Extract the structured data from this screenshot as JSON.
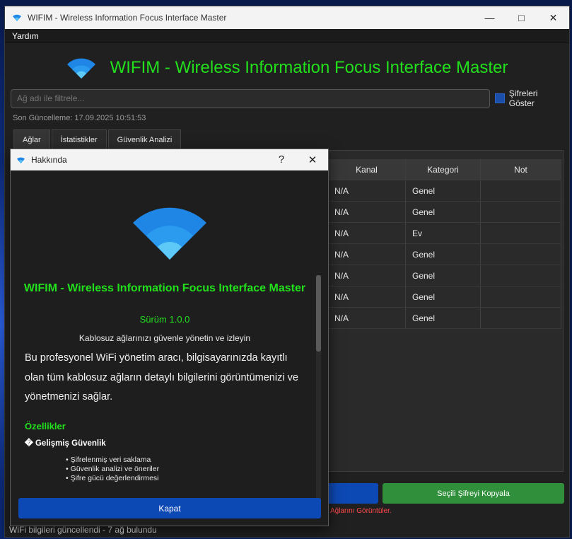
{
  "window": {
    "title": "WIFIM - Wireless Information Focus Interface Master"
  },
  "menu": {
    "help": "Yardım"
  },
  "header": {
    "title": "WIFIM - Wireless Information Focus Interface Master"
  },
  "filter": {
    "placeholder": "Ağ adı ile filtrele..."
  },
  "show_passwords": {
    "label": "Şifreleri Göster"
  },
  "last_update": "Son Güncelleme: 17.09.2025 10:51:53",
  "tabs": [
    {
      "label": "Ağlar"
    },
    {
      "label": "İstatistikler"
    },
    {
      "label": "Güvenlik Analizi"
    }
  ],
  "table": {
    "headers": [
      "Kanal",
      "Kategori",
      "Not"
    ],
    "rows": [
      [
        "N/A",
        "Genel",
        ""
      ],
      [
        "N/A",
        "Genel",
        ""
      ],
      [
        "N/A",
        "Ev",
        ""
      ],
      [
        "N/A",
        "Genel",
        ""
      ],
      [
        "N/A",
        "Genel",
        ""
      ],
      [
        "N/A",
        "Genel",
        ""
      ],
      [
        "N/A",
        "Genel",
        ""
      ]
    ]
  },
  "actions": {
    "copy_label": "Seçili Şifreyi Kopyala"
  },
  "hint": "Ağlarını Görüntüler.",
  "status": "WiFi bilgileri güncellendi - 7 ağ bulundu",
  "about": {
    "title": "Hakkında",
    "help_glyph": "?",
    "app_name": "WIFIM - Wireless Information Focus Interface Master",
    "version": "Sürüm 1.0.0",
    "subtitle": "Kablosuz ağlarınızı güvenle yönetin ve izleyin",
    "description": "Bu profesyonel WiFi yönetim aracı, bilgisayarınızda kayıtlı olan tüm kablosuz ağların detaylı bilgilerini görüntümenizi ve yönetmenizi sağlar.",
    "features_heading": "Özellikler",
    "security_heading": "� Gelişmiş Güvenlik",
    "security_items": [
      "Şifrelenmiş veri saklama",
      "Güvenlik analizi ve öneriler",
      "Şifre gücü değerlendirmesi"
    ],
    "close_label": "Kapat"
  },
  "colors": {
    "accent_green": "#22e01c",
    "primary_blue": "#0d49b5",
    "copy_green": "#2f8f3a",
    "warning_red": "#ff4a4a"
  }
}
